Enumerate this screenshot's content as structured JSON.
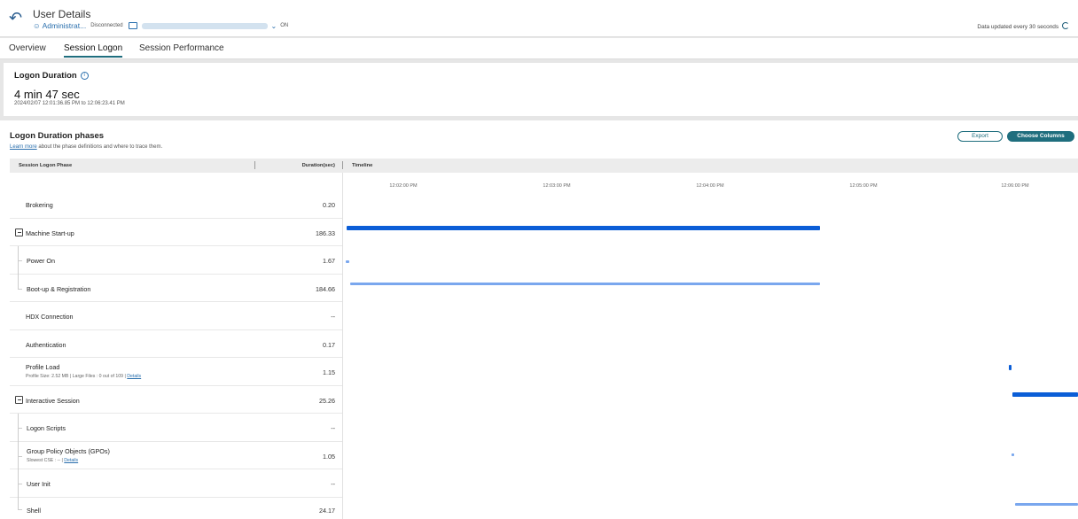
{
  "header": {
    "title": "User Details",
    "user": "Administrat...",
    "connection_status": "Disconnected",
    "machine_state": "ON",
    "updated_text": "Data updated every 30 seconds"
  },
  "tabs": [
    {
      "label": "Overview",
      "active": false
    },
    {
      "label": "Session Logon",
      "active": true
    },
    {
      "label": "Session Performance",
      "active": false
    }
  ],
  "logon_duration": {
    "heading": "Logon Duration",
    "total": "4 min 47 sec",
    "range": "2024/02/07 12:01:36.85 PM to 12:06:23.41 PM"
  },
  "phases": {
    "heading": "Logon Duration phases",
    "learn_more": "Learn more",
    "learn_more_rest": " about the phase definitions and where to trace them.",
    "export_label": "Export",
    "columns_label": "Choose Columns",
    "col_phase": "Session Logon Phase",
    "col_duration": "Duration(sec)",
    "col_timeline": "Timeline",
    "ticks": [
      "12:02:00 PM",
      "12:03:00 PM",
      "12:04:00 PM",
      "12:05:00 PM",
      "12:06:00 PM"
    ],
    "rows": [
      {
        "label": "Brokering",
        "value": "0.20"
      },
      {
        "label": "Machine Start-up",
        "value": "186.33"
      },
      {
        "label": "Power On",
        "value": "1.67"
      },
      {
        "label": "Boot-up & Registration",
        "value": "184.66"
      },
      {
        "label": "HDX Connection",
        "value": "--"
      },
      {
        "label": "Authentication",
        "value": "0.17"
      },
      {
        "label": "Profile Load",
        "value": "1.15",
        "sub_info": "Profile Size: 2.52 MB  |  Large Files : 0 out of 109  |",
        "sub_link": "Details"
      },
      {
        "label": "Interactive Session",
        "value": "25.26"
      },
      {
        "label": "Logon Scripts",
        "value": "--"
      },
      {
        "label": "Group Policy Objects (GPOs)",
        "value": "1.05",
        "sub_info": "Slowest CSE : --  |",
        "sub_link": "Details"
      },
      {
        "label": "User Init",
        "value": "--"
      },
      {
        "label": "Shell",
        "value": "24.17"
      }
    ]
  },
  "colors": {
    "accent": "#1f6e7e",
    "bar_primary": "#0b5ed7",
    "bar_secondary": "#7aa7ee",
    "link": "#2a6fad"
  }
}
